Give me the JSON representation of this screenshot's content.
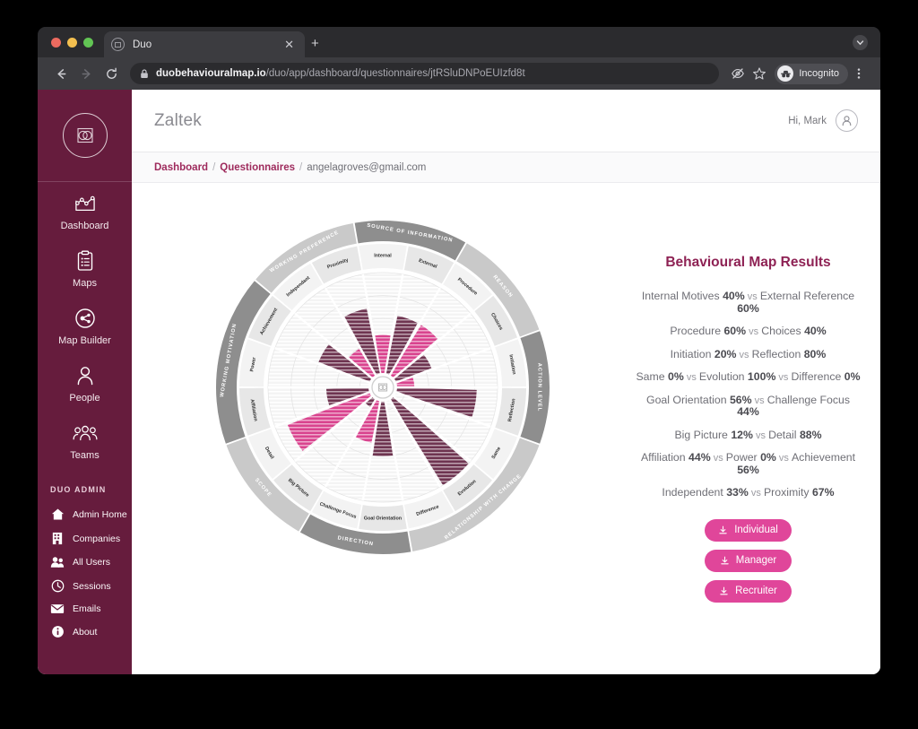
{
  "browser": {
    "tab": {
      "title": "Duo",
      "favicon_icon": "duo-logo-icon",
      "close_icon": "close-icon"
    },
    "new_tab_label": "+",
    "nav": {
      "back_icon": "back-arrow-icon",
      "forward_icon": "forward-arrow-icon",
      "reload_icon": "reload-icon"
    },
    "omnibox": {
      "lock_icon": "lock-icon",
      "domain": "duobehaviouralmap.io",
      "path": "/duo/app/dashboard/questionnaires/jtRSluDNPoEUIzfd8t"
    },
    "tracking_protection_icon": "eye-slash-icon",
    "bookmark_icon": "star-icon",
    "profile": {
      "label": "Incognito",
      "icon": "incognito-icon"
    },
    "menu_icon": "kebab-menu-icon",
    "tabstrip_button_icon": "chevron-down-circle-icon"
  },
  "sidebar": {
    "logo_icon": "duo-brand-logo-icon",
    "items": [
      {
        "label": "Dashboard",
        "icon": "chart-line-icon"
      },
      {
        "label": "Maps",
        "icon": "clipboard-list-icon"
      },
      {
        "label": "Map Builder",
        "icon": "node-network-icon"
      },
      {
        "label": "People",
        "icon": "person-icon"
      },
      {
        "label": "Teams",
        "icon": "people-group-icon"
      }
    ],
    "admin": {
      "title": "DUO ADMIN",
      "items": [
        {
          "label": "Admin Home",
          "icon": "home-icon"
        },
        {
          "label": "Companies",
          "icon": "building-icon"
        },
        {
          "label": "All Users",
          "icon": "users-icon"
        },
        {
          "label": "Sessions",
          "icon": "clock-icon"
        },
        {
          "label": "Emails",
          "icon": "envelope-icon"
        },
        {
          "label": "About",
          "icon": "info-icon"
        }
      ]
    }
  },
  "header": {
    "title": "Zaltek",
    "greeting": "Hi, Mark",
    "avatar_icon": "user-avatar-icon"
  },
  "breadcrumb": {
    "items": [
      {
        "label": "Dashboard",
        "link": true
      },
      {
        "label": "Questionnaires",
        "link": true
      },
      {
        "label": "angelagroves@gmail.com",
        "link": false
      }
    ],
    "separator": "/"
  },
  "results": {
    "title": "Behavioural Map Results",
    "vs_label": "vs",
    "rows": [
      {
        "parts": [
          {
            "name": "Internal Motives",
            "pct": "40%"
          },
          {
            "name": "External Reference",
            "pct": "60%"
          }
        ]
      },
      {
        "parts": [
          {
            "name": "Procedure",
            "pct": "60%"
          },
          {
            "name": "Choices",
            "pct": "40%"
          }
        ]
      },
      {
        "parts": [
          {
            "name": "Initiation",
            "pct": "20%"
          },
          {
            "name": "Reflection",
            "pct": "80%"
          }
        ]
      },
      {
        "parts": [
          {
            "name": "Same",
            "pct": "0%"
          },
          {
            "name": "Evolution",
            "pct": "100%"
          },
          {
            "name": "Difference",
            "pct": "0%"
          }
        ]
      },
      {
        "parts": [
          {
            "name": "Goal Orientation",
            "pct": "56%"
          },
          {
            "name": "Challenge Focus",
            "pct": "44%"
          }
        ]
      },
      {
        "parts": [
          {
            "name": "Big Picture",
            "pct": "12%"
          },
          {
            "name": "Detail",
            "pct": "88%"
          }
        ]
      },
      {
        "parts": [
          {
            "name": "Affiliation",
            "pct": "44%"
          },
          {
            "name": "Power",
            "pct": "0%"
          },
          {
            "name": "Achievement",
            "pct": "56%"
          }
        ]
      },
      {
        "parts": [
          {
            "name": "Independent",
            "pct": "33%"
          },
          {
            "name": "Proximity",
            "pct": "67%"
          }
        ]
      }
    ],
    "downloads": [
      {
        "label": "Individual",
        "icon": "download-icon"
      },
      {
        "label": "Manager",
        "icon": "download-icon"
      },
      {
        "label": "Recruiter",
        "icon": "download-icon"
      }
    ]
  },
  "chart_data": {
    "type": "bar",
    "subtype": "polar-rose",
    "title": "Behavioural Map Results",
    "center_icon": "duo-logo-icon",
    "rmax": 100,
    "grid": true,
    "colors": {
      "pink": "#d9438e",
      "maroon": "#6e3450",
      "ring_dark": "#8e8e8e",
      "ring_light": "#c9c9c9",
      "plot_bg": "#f2f2f2"
    },
    "categories": [
      "Internal",
      "External",
      "Procedure",
      "Choices",
      "Initiation",
      "Reflection",
      "Same",
      "Evolution",
      "Difference",
      "Goal Orientation",
      "Challenge Focus",
      "Big Picture",
      "Detail",
      "Affiliation",
      "Power",
      "Achievement",
      "Independant",
      "Proximity"
    ],
    "values": [
      40,
      60,
      60,
      40,
      20,
      80,
      0,
      100,
      0,
      56,
      44,
      12,
      88,
      44,
      0,
      56,
      33,
      67
    ],
    "segment_colors": [
      "pink",
      "maroon",
      "pink",
      "maroon",
      "pink",
      "maroon",
      "pink",
      "maroon",
      "pink",
      "maroon",
      "pink",
      "maroon",
      "pink",
      "maroon",
      "pink",
      "maroon",
      "pink",
      "maroon"
    ],
    "groups": [
      {
        "label": "SOURCE OF INFORMATION",
        "segments": [
          "Internal",
          "External"
        ],
        "shade": "dark"
      },
      {
        "label": "REASON",
        "segments": [
          "Procedure",
          "Choices"
        ],
        "shade": "light"
      },
      {
        "label": "ACTION LEVEL",
        "segments": [
          "Initiation",
          "Reflection"
        ],
        "shade": "dark"
      },
      {
        "label": "RELATIONSHIP WITH CHANGE",
        "segments": [
          "Same",
          "Evolution",
          "Difference"
        ],
        "shade": "light"
      },
      {
        "label": "DIRECTION",
        "segments": [
          "Goal Orientation",
          "Challenge Focus"
        ],
        "shade": "dark"
      },
      {
        "label": "SCOPE",
        "segments": [
          "Big Picture",
          "Detail"
        ],
        "shade": "light"
      },
      {
        "label": "WORKING MOTIVATION",
        "segments": [
          "Affiliation",
          "Power",
          "Achievement"
        ],
        "shade": "dark"
      },
      {
        "label": "WORKING PREFERENCE",
        "segments": [
          "Independant",
          "Proximity"
        ],
        "shade": "light"
      }
    ],
    "xlabel": "",
    "ylabel": "",
    "legend": null
  }
}
